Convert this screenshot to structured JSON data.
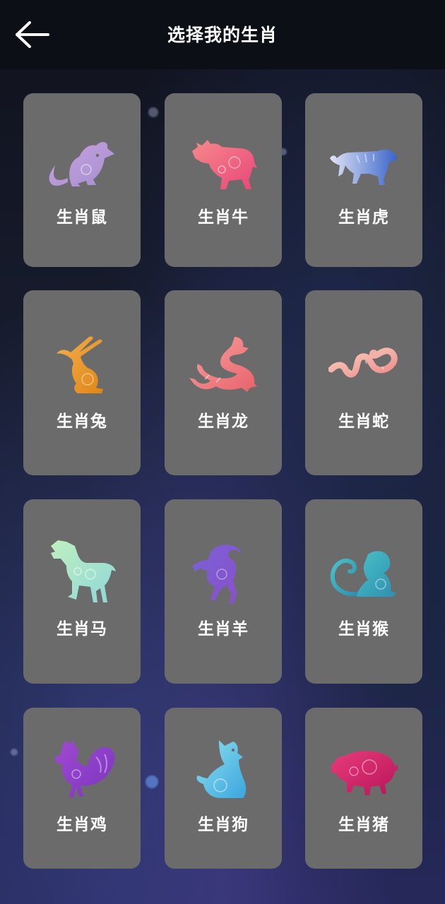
{
  "header": {
    "title": "选择我的生肖",
    "back_icon": "arrow-left-icon"
  },
  "zodiac": [
    {
      "label": "生肖鼠",
      "icon": "rat-icon",
      "color_a": "#c9a3e0",
      "color_b": "#a58fd0"
    },
    {
      "label": "生肖牛",
      "icon": "ox-icon",
      "color_a": "#f78a8a",
      "color_b": "#e8457a"
    },
    {
      "label": "生肖虎",
      "icon": "tiger-icon",
      "color_a": "#dfe4f7",
      "color_b": "#3a63c8"
    },
    {
      "label": "生肖兔",
      "icon": "rabbit-icon",
      "color_a": "#f2b04a",
      "color_b": "#e08518"
    },
    {
      "label": "生肖龙",
      "icon": "dragon-icon",
      "color_a": "#f7a2a0",
      "color_b": "#e8616a"
    },
    {
      "label": "生肖蛇",
      "icon": "snake-icon",
      "color_a": "#f9d0c0",
      "color_b": "#ee8c8a"
    },
    {
      "label": "生肖马",
      "icon": "horse-icon",
      "color_a": "#bff0c0",
      "color_b": "#8fd7d9"
    },
    {
      "label": "生肖羊",
      "icon": "goat-icon",
      "color_a": "#7a62d6",
      "color_b": "#8a4fc8"
    },
    {
      "label": "生肖猴",
      "icon": "monkey-icon",
      "color_a": "#48c1c8",
      "color_b": "#2f8fb0"
    },
    {
      "label": "生肖鸡",
      "icon": "rooster-icon",
      "color_a": "#a04ad0",
      "color_b": "#7b35c0"
    },
    {
      "label": "生肖狗",
      "icon": "dog-icon",
      "color_a": "#8fe0ef",
      "color_b": "#3aa6de"
    },
    {
      "label": "生肖猪",
      "icon": "pig-icon",
      "color_a": "#e83d7a",
      "color_b": "#b8135a"
    }
  ]
}
